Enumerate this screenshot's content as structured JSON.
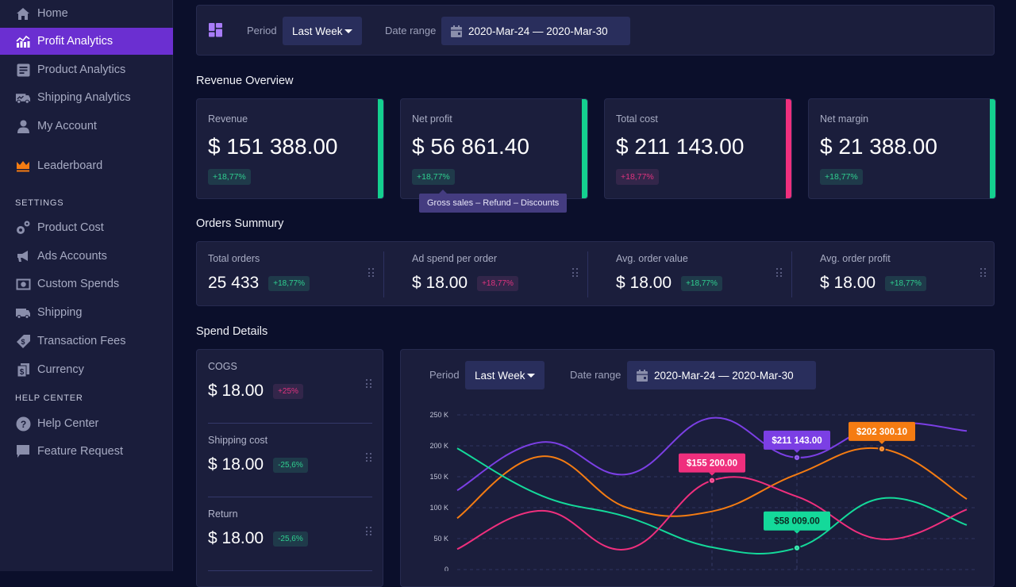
{
  "sidebar": {
    "items": [
      {
        "label": "Home",
        "icon": "home-icon",
        "active": false
      },
      {
        "label": "Profit Analytics",
        "icon": "analytics-icon",
        "active": true
      },
      {
        "label": "Product Analytics",
        "icon": "document-icon",
        "active": false
      },
      {
        "label": "Shipping Analytics",
        "icon": "truck-chart-icon",
        "active": false
      },
      {
        "label": "My Account",
        "icon": "user-icon",
        "active": false
      },
      {
        "label": "Leaderboard",
        "icon": "crown-icon",
        "active": false
      }
    ],
    "settings_heading": "SETTINGS",
    "settings_items": [
      {
        "label": "Product Cost",
        "icon": "gears-icon"
      },
      {
        "label": "Ads Accounts",
        "icon": "megaphone-icon"
      },
      {
        "label": "Custom Spends",
        "icon": "money-icon"
      },
      {
        "label": "Shipping",
        "icon": "truck-icon"
      },
      {
        "label": "Transaction Fees",
        "icon": "price-tag-icon"
      },
      {
        "label": "Currency",
        "icon": "currency-icon"
      }
    ],
    "help_heading": "HELP CENTER",
    "help_items": [
      {
        "label": "Help Center",
        "icon": "question-icon"
      },
      {
        "label": "Feature Request",
        "icon": "chat-icon"
      }
    ]
  },
  "filters": {
    "period_label": "Period",
    "period_value": "Last Week",
    "date_label": "Date range",
    "date_value": "2020-Mar-24 — 2020-Mar-30"
  },
  "revenue_overview": {
    "title": "Revenue Overview",
    "cards": [
      {
        "title": "Revenue",
        "value": "$ 151 388.00",
        "change": "+18,77%",
        "trend": "up",
        "accent": "#14d08f"
      },
      {
        "title": "Net profit",
        "value": "$ 56 861.40",
        "change": "+18,77%",
        "trend": "up",
        "accent": "#14d08f"
      },
      {
        "title": "Total cost",
        "value": "$ 211 143.00",
        "change": "+18,77%",
        "trend": "down",
        "accent": "#ef2f7d"
      },
      {
        "title": "Net margin",
        "value": "$ 21 388.00",
        "change": "+18,77%",
        "trend": "up",
        "accent": "#14d08f"
      }
    ],
    "tooltip": "Gross sales – Refund – Discounts"
  },
  "orders_summary": {
    "title": "Orders Summury",
    "items": [
      {
        "title": "Total orders",
        "value": "25 433",
        "change": "+18,77%",
        "trend": "up"
      },
      {
        "title": "Ad spend per order",
        "value": "$ 18.00",
        "change": "+18,77%",
        "trend": "down"
      },
      {
        "title": "Avg. order value",
        "value": "$ 18.00",
        "change": "+18,77%",
        "trend": "up"
      },
      {
        "title": "Avg. order profit",
        "value": "$ 18.00",
        "change": "+18,77%",
        "trend": "up"
      }
    ]
  },
  "spend_details": {
    "title": "Spend Details",
    "items": [
      {
        "title": "COGS",
        "value": "$ 18.00",
        "change": "+25%",
        "trend": "down"
      },
      {
        "title": "Shipping cost",
        "value": "$ 18.00",
        "change": "-25,6%",
        "trend": "up"
      },
      {
        "title": "Return",
        "value": "$ 18.00",
        "change": "-25,6%",
        "trend": "up"
      }
    ],
    "chart_filters": {
      "period_label": "Period",
      "period_value": "Last Week",
      "date_label": "Date range",
      "date_value": "2020-Mar-24 — 2020-Mar-30"
    }
  },
  "chart_data": {
    "type": "line",
    "title": "",
    "xlabel": "",
    "ylabel": "",
    "ylim": [
      0,
      250000
    ],
    "yticks": [
      "0",
      "50 K",
      "100 K",
      "150 K",
      "200 K",
      "250 K"
    ],
    "ytick_values": [
      0,
      50000,
      100000,
      150000,
      200000,
      250000
    ],
    "x": [
      1,
      2,
      3,
      4,
      5,
      6,
      7
    ],
    "grid": true,
    "series": [
      {
        "name": "purple",
        "color": "#7b3fe4",
        "values": [
          128000,
          206000,
          154000,
          245000,
          181000,
          235000,
          224000
        ]
      },
      {
        "name": "orange",
        "color": "#f57c12",
        "values": [
          83000,
          183000,
          100000,
          94000,
          154000,
          195000,
          114000
        ]
      },
      {
        "name": "green",
        "color": "#14d99a",
        "values": [
          196000,
          119000,
          85000,
          36000,
          35000,
          115000,
          72000
        ]
      },
      {
        "name": "pink",
        "color": "#ef2f7d",
        "values": [
          33000,
          95000,
          33000,
          144000,
          118000,
          49000,
          97000
        ]
      }
    ],
    "annotations": [
      {
        "series": "pink",
        "x": 4,
        "label": "$155 200.00",
        "text_color": "#ffffff"
      },
      {
        "series": "purple",
        "x": 5,
        "label": "$211 143.00",
        "text_color": "#ffffff"
      },
      {
        "series": "orange",
        "x": 6,
        "label": "$202 300.10",
        "text_color": "#ffffff"
      },
      {
        "series": "green",
        "x": 5,
        "label": "$58 009.00",
        "text_color": "#0b2a22"
      }
    ]
  }
}
